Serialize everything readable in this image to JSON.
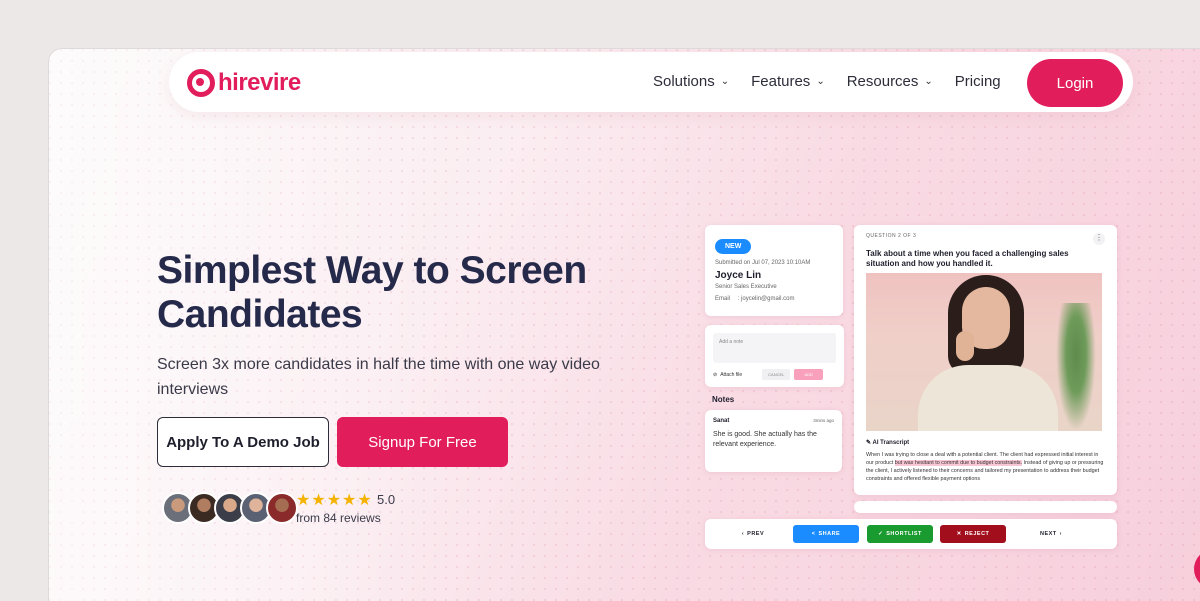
{
  "brand": {
    "name": "hirevire",
    "color": "#e11d5b"
  },
  "nav": {
    "items": [
      {
        "label": "Solutions",
        "has_dropdown": true
      },
      {
        "label": "Features",
        "has_dropdown": true
      },
      {
        "label": "Resources",
        "has_dropdown": true
      },
      {
        "label": "Pricing",
        "has_dropdown": false
      }
    ],
    "login_label": "Login"
  },
  "hero": {
    "headline": "Simplest Way to Screen Candidates",
    "subtext": "Screen 3x more candidates in half the time with one way video interviews",
    "demo_button": "Apply To A Demo Job",
    "signup_button": "Signup For Free",
    "rating": "5.0",
    "stars": 5,
    "reviews": "from 84 reviews"
  },
  "mock": {
    "badge": "NEW",
    "submitted": "Submitted on Jul 07, 2023 10:10AM",
    "candidate_name": "Joyce Lin",
    "candidate_role": "Senior Sales Executive",
    "email_label": "Email",
    "email_value": "joycelin@gmail.com",
    "note_placeholder": "Add a note",
    "attach_label": "Attach file",
    "cancel_label": "CANCEL",
    "add_label": "ADD",
    "notes_heading": "Notes",
    "note_author": "Sanat",
    "note_time": "3mins ago",
    "note_text": "She is good. She actually has the relevant experience.",
    "question_label": "QUESTION 2 OF 3",
    "question_text": "Talk about a time when you faced a challenging sales situation and how you handled it.",
    "ai_label": "AI Transcript",
    "transcript_a": "When I was trying to close a deal with a potential client. The client had expressed initial interest in our product ",
    "transcript_hl": "but was hesitant to commit due to budget constraints.",
    "transcript_b": " Instead of giving up or pressuring the client, I actively listened to their concerns and tailored my presentation to address their budget constraints and offered flexible payment options",
    "prev_label": "PREV",
    "share_label": "SHARE",
    "shortlist_label": "SHORTLIST",
    "reject_label": "REJECT",
    "next_label": "NEXT",
    "colors": {
      "share": "#1a8cff",
      "shortlist": "#1a9b2f",
      "reject": "#a30e1d",
      "new_badge": "#1a8cff"
    }
  }
}
